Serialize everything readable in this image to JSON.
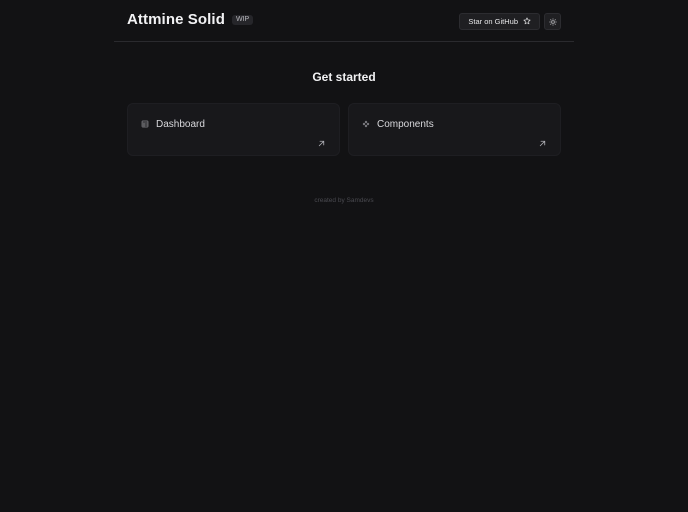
{
  "header": {
    "title": "Attmine Solid",
    "badge": "WIP",
    "github_label": "Star on GitHub",
    "github_icon": "star-icon",
    "theme_icon": "sun-icon"
  },
  "main": {
    "heading": "Get started",
    "cards": [
      {
        "label": "Dashboard",
        "icon": "dashboard-icon",
        "arrow_icon": "arrow-up-right-icon"
      },
      {
        "label": "Components",
        "icon": "components-icon",
        "arrow_icon": "arrow-up-right-icon"
      }
    ]
  },
  "footer": {
    "text": "created by Samdevs"
  },
  "colors": {
    "background": "#121214",
    "card": "#18181b",
    "text": "#e6e6e8",
    "muted": "#4a4a50"
  }
}
